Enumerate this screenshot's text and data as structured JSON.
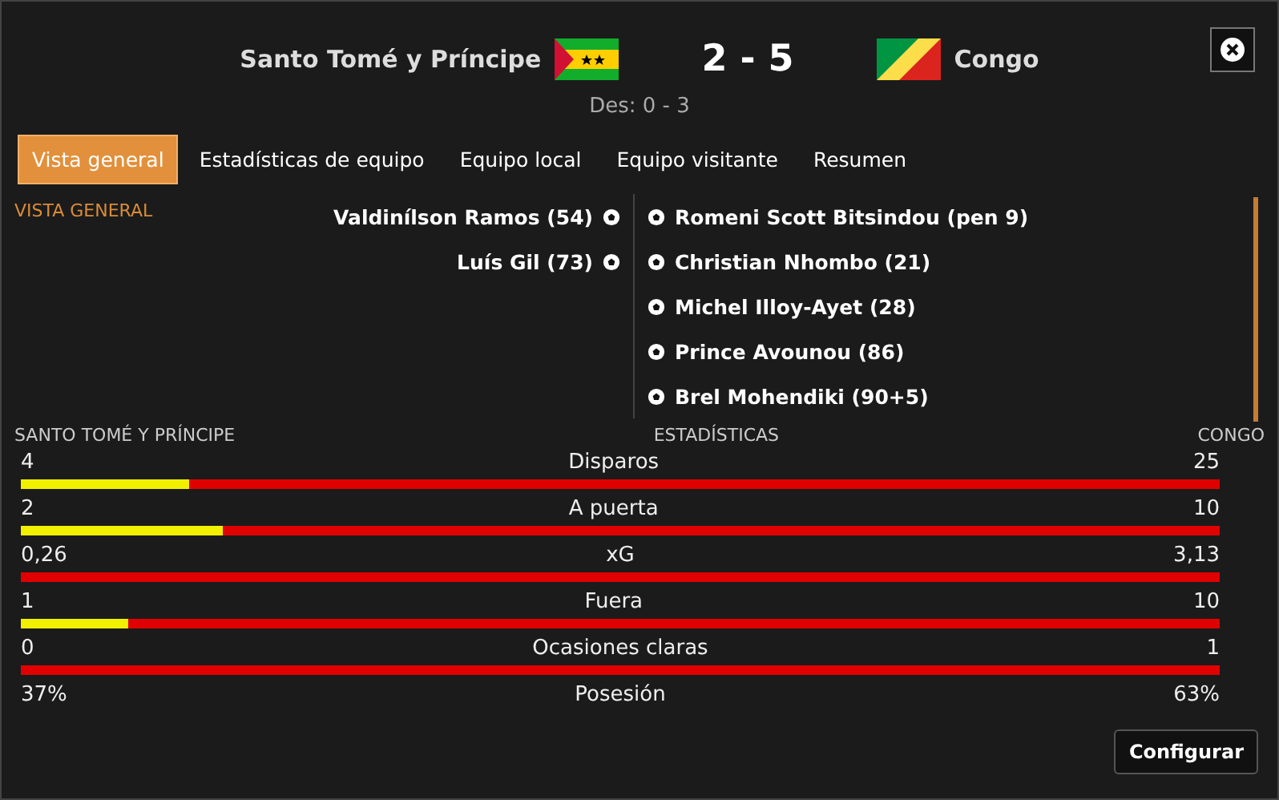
{
  "header": {
    "home_team": "Santo Tomé y Príncipe",
    "score": "2 - 5",
    "away_team": "Congo",
    "halftime": "Des: 0 - 3"
  },
  "tabs": [
    {
      "label": "Vista general",
      "selected": true
    },
    {
      "label": "Estadísticas de equipo",
      "selected": false
    },
    {
      "label": "Equipo local",
      "selected": false
    },
    {
      "label": "Equipo visitante",
      "selected": false
    },
    {
      "label": "Resumen",
      "selected": false
    }
  ],
  "section_title": "VISTA GENERAL",
  "home_goals": [
    "Valdinílson Ramos (54)",
    "Luís Gil (73)"
  ],
  "away_goals": [
    "Romeni Scott Bitsindou (pen 9)",
    "Christian Nhombo (21)",
    "Michel Illoy-Ayet (28)",
    "Prince Avounou (86)",
    "Brel Mohendiki (90+5)"
  ],
  "stats_header": {
    "home": "SANTO TOMÉ Y PRÍNCIPE",
    "title": "ESTADÍSTICAS",
    "away": "CONGO"
  },
  "stats": [
    {
      "kind": "bar",
      "name": "Disparos",
      "home": "4",
      "away": "25",
      "level": 0.14
    },
    {
      "kind": "bar",
      "name": "A puerta",
      "home": "2",
      "away": "10",
      "level": 0.168
    },
    {
      "kind": "bar",
      "name": "xG",
      "home": "0,26",
      "away": "3,13"
    },
    {
      "kind": "bar",
      "name": "Fuera",
      "home": "1",
      "away": "10",
      "level": 0.09
    },
    {
      "kind": "bar",
      "name": "Ocasiones claras",
      "home": "0",
      "away": "1"
    },
    {
      "kind": "text",
      "name": "Posesión",
      "home": "37%",
      "away": "63%"
    }
  ],
  "configure_button": "Configurar"
}
